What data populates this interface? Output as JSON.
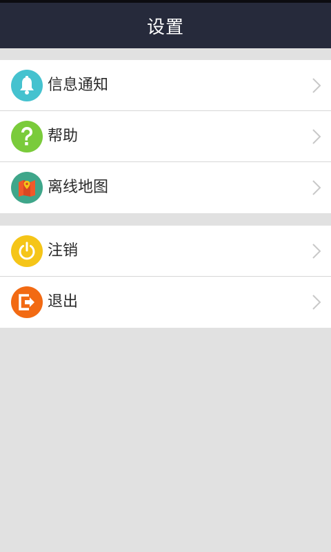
{
  "header": {
    "title": "设置"
  },
  "groups": [
    {
      "items": [
        {
          "label": "信息通知",
          "icon": "bell-icon",
          "color": "#45c2cf"
        },
        {
          "label": "帮助",
          "icon": "question-icon",
          "color": "#7acb3b"
        },
        {
          "label": "离线地图",
          "icon": "map-icon",
          "color": "#3fa68a"
        }
      ]
    },
    {
      "items": [
        {
          "label": "注销",
          "icon": "power-icon",
          "color": "#f5c518"
        },
        {
          "label": "退出",
          "icon": "exit-icon",
          "color": "#f26a13"
        }
      ]
    }
  ],
  "colors": {
    "header_bg": "#262a3b",
    "page_bg": "#e1e1e1",
    "separator": "#d6d6d6",
    "chevron": "#c8c8c8"
  }
}
